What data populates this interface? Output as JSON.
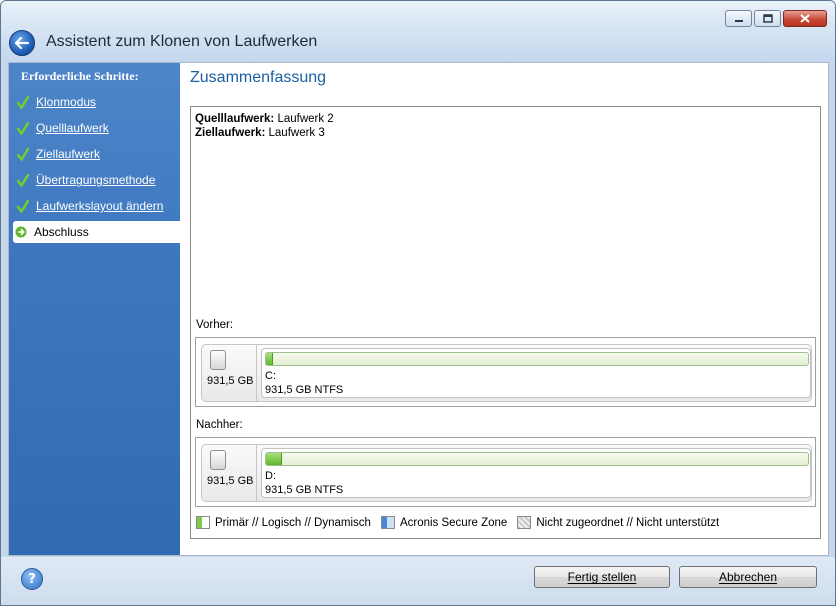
{
  "window": {
    "title": "Assistent zum Klonen von Laufwerken"
  },
  "sidebar": {
    "title": "Erforderliche Schritte:",
    "items": [
      {
        "label": "Klonmodus",
        "status": "done"
      },
      {
        "label": "Quelllaufwerk",
        "status": "done"
      },
      {
        "label": "Ziellaufwerk",
        "status": "done"
      },
      {
        "label": "Übertragungsmethode",
        "status": "done"
      },
      {
        "label": "Laufwerkslayout ändern",
        "status": "done"
      },
      {
        "label": "Abschluss",
        "status": "current"
      }
    ]
  },
  "main": {
    "title": "Zusammenfassung",
    "summary": {
      "source_label": "Quelllaufwerk:",
      "source_value": "Laufwerk 2",
      "target_label": "Ziellaufwerk:",
      "target_value": "Laufwerk 3"
    },
    "before": {
      "label": "Vorher:",
      "disk_size": "931,5 GB",
      "partition_letter": "C:",
      "partition_info": "931,5 GB  NTFS",
      "used_fraction": 0.012
    },
    "after": {
      "label": "Nachher:",
      "disk_size": "931,5 GB",
      "partition_letter": "D:",
      "partition_info": "931,5 GB  NTFS",
      "used_fraction": 0.03
    },
    "legend": [
      {
        "label": "Primär // Logisch // Dynamisch",
        "color": "#7fcb4a"
      },
      {
        "label": "Acronis Secure Zone",
        "color": "#4a86d6"
      },
      {
        "label": "Nicht zugeordnet // Nicht unterstützt",
        "color": "#c8c8c8"
      }
    ]
  },
  "buttons": {
    "finish_label": "Fertig stellen",
    "cancel_label": "Abbrechen"
  },
  "colors": {
    "accent": "#1b5fa4",
    "sidebar": "#3e78c0",
    "check": "#5fc31f"
  }
}
